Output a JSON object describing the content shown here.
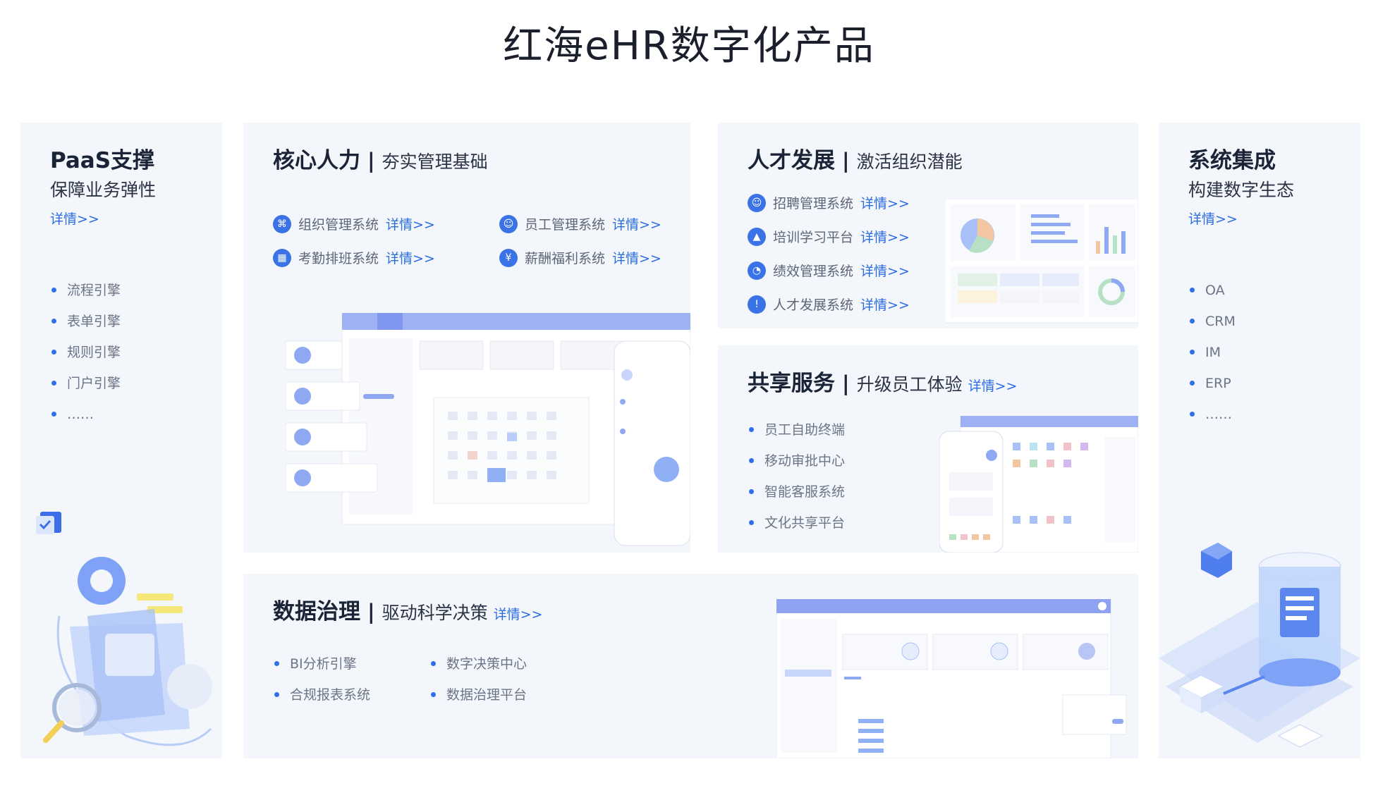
{
  "page": {
    "title": "红海eHR数字化产品"
  },
  "paas": {
    "title": "PaaS支撑",
    "subtitle": "保障业务弹性",
    "detail": "详情>>",
    "items": [
      "流程引擎",
      "表单引擎",
      "规则引擎",
      "门户引擎",
      "……"
    ]
  },
  "core": {
    "title": "核心人力",
    "separator": "|",
    "subtitle": "夯实管理基础",
    "systems": [
      {
        "label": "组织管理系统",
        "link": "详情>>",
        "icon": "org-icon"
      },
      {
        "label": "员工管理系统",
        "link": "详情>>",
        "icon": "user-icon"
      },
      {
        "label": "考勤排班系统",
        "link": "详情>>",
        "icon": "calendar-icon"
      },
      {
        "label": "薪酬福利系统",
        "link": "详情>>",
        "icon": "yen-icon"
      }
    ]
  },
  "talent": {
    "title": "人才发展",
    "separator": "|",
    "subtitle": "激活组织潜能",
    "systems": [
      {
        "label": "招聘管理系统",
        "link": "详情>>",
        "icon": "recruit-icon"
      },
      {
        "label": "培训学习平台",
        "link": "详情>>",
        "icon": "graduation-cap-icon"
      },
      {
        "label": "绩效管理系统",
        "link": "详情>>",
        "icon": "pie-chart-icon"
      },
      {
        "label": "人才发展系统",
        "link": "详情>>",
        "icon": "thermometer-icon"
      }
    ]
  },
  "share": {
    "title": "共享服务",
    "separator": "|",
    "subtitle": "升级员工体验",
    "link": "详情>>",
    "items": [
      "员工自助终端",
      "移动审批中心",
      "智能客服系统",
      "文化共享平台"
    ]
  },
  "data": {
    "title": "数据治理",
    "separator": "|",
    "subtitle": "驱动科学决策",
    "link": "详情>>",
    "col1": [
      "BI分析引擎",
      "合规报表系统"
    ],
    "col2": [
      "数字决策中心",
      "数据治理平台"
    ]
  },
  "sys": {
    "title": "系统集成",
    "subtitle": "构建数字生态",
    "detail": "详情>>",
    "items": [
      "OA",
      "CRM",
      "IM",
      "ERP",
      "……"
    ]
  },
  "colors": {
    "accent": "#2a6ce4",
    "card_bg": "#f3f6fb",
    "bullet": "#2f6fe8",
    "illustration_blue": "#8fa6f2"
  }
}
